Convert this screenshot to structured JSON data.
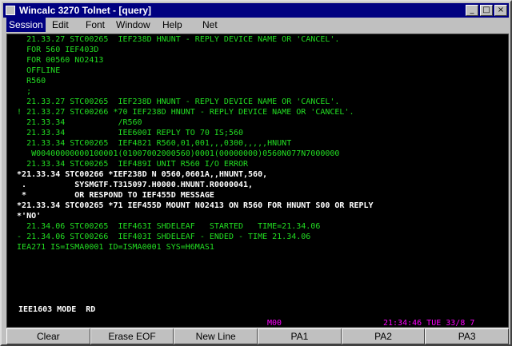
{
  "window": {
    "title": "Wincalc 3270 Tolnet - [query]",
    "controls": {
      "minimize": "_",
      "maximize": "□",
      "close": "×"
    }
  },
  "menu": [
    "Session",
    "Edit",
    "Font",
    "Window",
    "Help",
    "Net"
  ],
  "terminal": {
    "lines": [
      "    21.33.27 STC00265  IEF238D HNUNT - REPLY DEVICE NAME OR 'CANCEL'.",
      "    FOR 560 IEF403D",
      "    FOR 00560 NO2413",
      "    OFFLINE",
      "    R560",
      "    ;",
      "    21.33.27 STC00265  IEF238D HNUNT - REPLY DEVICE NAME OR 'CANCEL'.",
      "  ! 21.33.27 STC00266 *70 IEF238D HNUNT - REPLY DEVICE NAME OR 'CANCEL'.",
      "    21.33.34           /R560",
      "    21.33.34           IEE600I REPLY TO 70 IS;560",
      "    21.33.34 STC00265  IEF4821 R560,01,001,,,0300,,,,,HNUNT",
      "     W00400000000100001(01007002000560)0001(00000000)0560N077N7000000",
      "    21.33.34 STC00265  IEF489I UNIT R560 I/O ERROR",
      "  *21.33.34 STC00266 *IEF238D N 0560,0601A,,HNUNT,560,",
      "   .          SYSMGTF.T315097.H0000.HNUNT.R0000041,",
      "   *          OR RESPOND TO IEF455D MESSAGE",
      "  *21.33.34 STC00265 *71 IEF455D MOUNT N02413 ON R560 FOR HNUNT S00 OR REPLY",
      "  *'NO'",
      "    21.34.06 STC00265  IEF463I SHDELEAF   STARTED   TIME=21.34.06",
      "  - 21.34.06 STC00266  IEF403I SHDELEAF - ENDED - TIME 21.34.06",
      "  IEA271 IS=ISMA0001 ID=ISMA0001 SYS=H6MAS1"
    ],
    "command_line": "IEE1603 MODE  RD",
    "status_mid": "M00",
    "status_right": "21:34:46 TUE 33/8 7"
  },
  "buttons": [
    "Clear",
    "Erase EOF",
    "New Line",
    "PA1",
    "PA2",
    "PA3"
  ]
}
